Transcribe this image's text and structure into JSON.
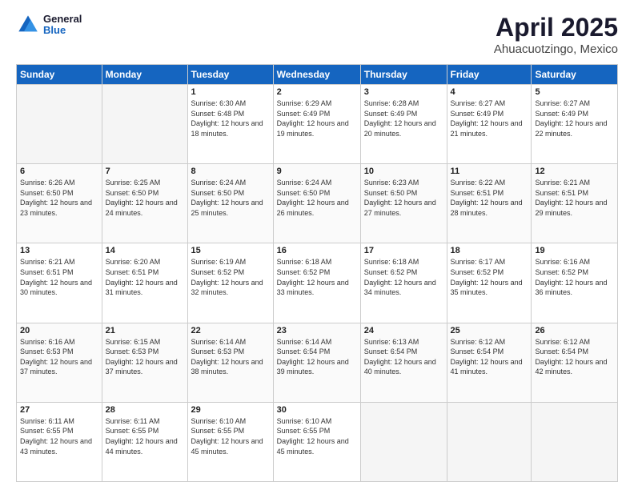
{
  "header": {
    "logo_general": "General",
    "logo_blue": "Blue",
    "title": "April 2025",
    "subtitle": "Ahuacuotzingo, Mexico"
  },
  "days_of_week": [
    "Sunday",
    "Monday",
    "Tuesday",
    "Wednesday",
    "Thursday",
    "Friday",
    "Saturday"
  ],
  "weeks": [
    [
      {
        "day": "",
        "sunrise": "",
        "sunset": "",
        "daylight": ""
      },
      {
        "day": "",
        "sunrise": "",
        "sunset": "",
        "daylight": ""
      },
      {
        "day": "1",
        "sunrise": "Sunrise: 6:30 AM",
        "sunset": "Sunset: 6:48 PM",
        "daylight": "Daylight: 12 hours and 18 minutes."
      },
      {
        "day": "2",
        "sunrise": "Sunrise: 6:29 AM",
        "sunset": "Sunset: 6:49 PM",
        "daylight": "Daylight: 12 hours and 19 minutes."
      },
      {
        "day": "3",
        "sunrise": "Sunrise: 6:28 AM",
        "sunset": "Sunset: 6:49 PM",
        "daylight": "Daylight: 12 hours and 20 minutes."
      },
      {
        "day": "4",
        "sunrise": "Sunrise: 6:27 AM",
        "sunset": "Sunset: 6:49 PM",
        "daylight": "Daylight: 12 hours and 21 minutes."
      },
      {
        "day": "5",
        "sunrise": "Sunrise: 6:27 AM",
        "sunset": "Sunset: 6:49 PM",
        "daylight": "Daylight: 12 hours and 22 minutes."
      }
    ],
    [
      {
        "day": "6",
        "sunrise": "Sunrise: 6:26 AM",
        "sunset": "Sunset: 6:50 PM",
        "daylight": "Daylight: 12 hours and 23 minutes."
      },
      {
        "day": "7",
        "sunrise": "Sunrise: 6:25 AM",
        "sunset": "Sunset: 6:50 PM",
        "daylight": "Daylight: 12 hours and 24 minutes."
      },
      {
        "day": "8",
        "sunrise": "Sunrise: 6:24 AM",
        "sunset": "Sunset: 6:50 PM",
        "daylight": "Daylight: 12 hours and 25 minutes."
      },
      {
        "day": "9",
        "sunrise": "Sunrise: 6:24 AM",
        "sunset": "Sunset: 6:50 PM",
        "daylight": "Daylight: 12 hours and 26 minutes."
      },
      {
        "day": "10",
        "sunrise": "Sunrise: 6:23 AM",
        "sunset": "Sunset: 6:50 PM",
        "daylight": "Daylight: 12 hours and 27 minutes."
      },
      {
        "day": "11",
        "sunrise": "Sunrise: 6:22 AM",
        "sunset": "Sunset: 6:51 PM",
        "daylight": "Daylight: 12 hours and 28 minutes."
      },
      {
        "day": "12",
        "sunrise": "Sunrise: 6:21 AM",
        "sunset": "Sunset: 6:51 PM",
        "daylight": "Daylight: 12 hours and 29 minutes."
      }
    ],
    [
      {
        "day": "13",
        "sunrise": "Sunrise: 6:21 AM",
        "sunset": "Sunset: 6:51 PM",
        "daylight": "Daylight: 12 hours and 30 minutes."
      },
      {
        "day": "14",
        "sunrise": "Sunrise: 6:20 AM",
        "sunset": "Sunset: 6:51 PM",
        "daylight": "Daylight: 12 hours and 31 minutes."
      },
      {
        "day": "15",
        "sunrise": "Sunrise: 6:19 AM",
        "sunset": "Sunset: 6:52 PM",
        "daylight": "Daylight: 12 hours and 32 minutes."
      },
      {
        "day": "16",
        "sunrise": "Sunrise: 6:18 AM",
        "sunset": "Sunset: 6:52 PM",
        "daylight": "Daylight: 12 hours and 33 minutes."
      },
      {
        "day": "17",
        "sunrise": "Sunrise: 6:18 AM",
        "sunset": "Sunset: 6:52 PM",
        "daylight": "Daylight: 12 hours and 34 minutes."
      },
      {
        "day": "18",
        "sunrise": "Sunrise: 6:17 AM",
        "sunset": "Sunset: 6:52 PM",
        "daylight": "Daylight: 12 hours and 35 minutes."
      },
      {
        "day": "19",
        "sunrise": "Sunrise: 6:16 AM",
        "sunset": "Sunset: 6:52 PM",
        "daylight": "Daylight: 12 hours and 36 minutes."
      }
    ],
    [
      {
        "day": "20",
        "sunrise": "Sunrise: 6:16 AM",
        "sunset": "Sunset: 6:53 PM",
        "daylight": "Daylight: 12 hours and 37 minutes."
      },
      {
        "day": "21",
        "sunrise": "Sunrise: 6:15 AM",
        "sunset": "Sunset: 6:53 PM",
        "daylight": "Daylight: 12 hours and 37 minutes."
      },
      {
        "day": "22",
        "sunrise": "Sunrise: 6:14 AM",
        "sunset": "Sunset: 6:53 PM",
        "daylight": "Daylight: 12 hours and 38 minutes."
      },
      {
        "day": "23",
        "sunrise": "Sunrise: 6:14 AM",
        "sunset": "Sunset: 6:54 PM",
        "daylight": "Daylight: 12 hours and 39 minutes."
      },
      {
        "day": "24",
        "sunrise": "Sunrise: 6:13 AM",
        "sunset": "Sunset: 6:54 PM",
        "daylight": "Daylight: 12 hours and 40 minutes."
      },
      {
        "day": "25",
        "sunrise": "Sunrise: 6:12 AM",
        "sunset": "Sunset: 6:54 PM",
        "daylight": "Daylight: 12 hours and 41 minutes."
      },
      {
        "day": "26",
        "sunrise": "Sunrise: 6:12 AM",
        "sunset": "Sunset: 6:54 PM",
        "daylight": "Daylight: 12 hours and 42 minutes."
      }
    ],
    [
      {
        "day": "27",
        "sunrise": "Sunrise: 6:11 AM",
        "sunset": "Sunset: 6:55 PM",
        "daylight": "Daylight: 12 hours and 43 minutes."
      },
      {
        "day": "28",
        "sunrise": "Sunrise: 6:11 AM",
        "sunset": "Sunset: 6:55 PM",
        "daylight": "Daylight: 12 hours and 44 minutes."
      },
      {
        "day": "29",
        "sunrise": "Sunrise: 6:10 AM",
        "sunset": "Sunset: 6:55 PM",
        "daylight": "Daylight: 12 hours and 45 minutes."
      },
      {
        "day": "30",
        "sunrise": "Sunrise: 6:10 AM",
        "sunset": "Sunset: 6:55 PM",
        "daylight": "Daylight: 12 hours and 45 minutes."
      },
      {
        "day": "",
        "sunrise": "",
        "sunset": "",
        "daylight": ""
      },
      {
        "day": "",
        "sunrise": "",
        "sunset": "",
        "daylight": ""
      },
      {
        "day": "",
        "sunrise": "",
        "sunset": "",
        "daylight": ""
      }
    ]
  ]
}
